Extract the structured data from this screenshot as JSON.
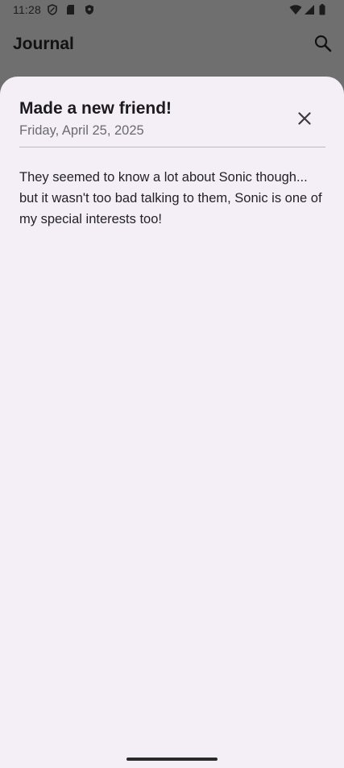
{
  "status_bar": {
    "time": "11:28",
    "left_icons": [
      "vpn-shield-icon",
      "sd-card-icon",
      "security-shield-icon"
    ],
    "right_icons": [
      "wifi-icon",
      "cell-signal-icon",
      "battery-icon"
    ]
  },
  "appbar": {
    "title": "Journal",
    "search_icon": "search-icon"
  },
  "entry": {
    "title": "Made a new friend!",
    "date": "Friday, April 25, 2025",
    "body": "They seemed to know a lot about Sonic though... but it wasn't too bad talking to them, Sonic is one of my special interests too!",
    "close_icon": "close-icon"
  },
  "colors": {
    "sheet_background": "#f4eff7",
    "scrim": "#6f6f6f"
  }
}
